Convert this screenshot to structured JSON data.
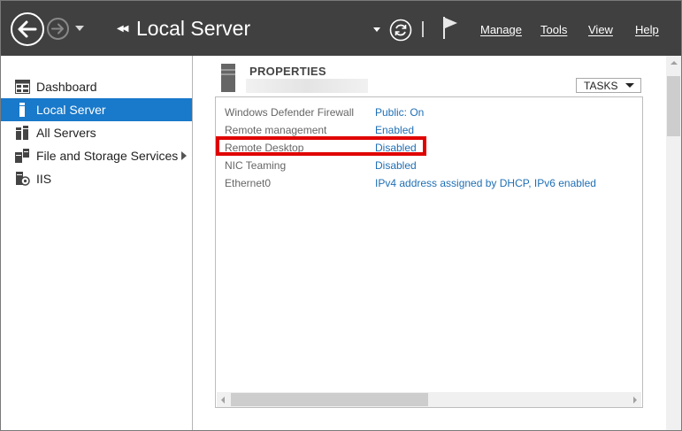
{
  "header": {
    "title": "Local Server",
    "menu": [
      {
        "label": "Manage"
      },
      {
        "label": "Tools"
      },
      {
        "label": "View"
      },
      {
        "label": "Help"
      }
    ]
  },
  "sidebar": {
    "items": [
      {
        "label": "Dashboard",
        "icon": "dashboard-icon",
        "active": false
      },
      {
        "label": "Local Server",
        "icon": "local-server-icon",
        "active": true
      },
      {
        "label": "All Servers",
        "icon": "all-servers-icon",
        "active": false
      },
      {
        "label": "File and Storage Services",
        "icon": "storage-icon",
        "active": false,
        "expandable": true
      },
      {
        "label": "IIS",
        "icon": "iis-icon",
        "active": false
      }
    ]
  },
  "properties": {
    "title": "PROPERTIES",
    "tasks_label": "TASKS",
    "rows": [
      {
        "name": "Windows Defender Firewall",
        "value": "Public: On"
      },
      {
        "name": "Remote management",
        "value": "Enabled"
      },
      {
        "name": "Remote Desktop",
        "value": "Disabled"
      },
      {
        "name": "NIC Teaming",
        "value": "Disabled"
      },
      {
        "name": "Ethernet0",
        "value": "IPv4 address assigned by DHCP, IPv6 enabled"
      }
    ]
  },
  "colors": {
    "header_bg": "#404040",
    "selection": "#1979ca",
    "link": "#1f6fb5",
    "highlight": "#e00000"
  }
}
